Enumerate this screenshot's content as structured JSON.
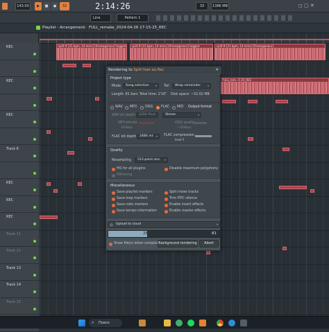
{
  "topbar": {
    "tempo": "143.00",
    "pattern_num": "32",
    "time": "2:14:26",
    "mode": "Line",
    "pattern": "Pattern 1",
    "cpu": "1386 MB",
    "poly": "33"
  },
  "playlist": {
    "title": "Playlist - Arrangement",
    "subtitle": "FULL_remake_2024-04-26 17-15-25_REC",
    "tracks": [
      {
        "name": "REC",
        "dim": false
      },
      {
        "name": "",
        "dim": false
      },
      {
        "name": "REC",
        "dim": false
      },
      {
        "name": "",
        "dim": false
      },
      {
        "name": "REC",
        "dim": false
      },
      {
        "name": "",
        "dim": false
      },
      {
        "name": "Track 6",
        "dim": false
      },
      {
        "name": "",
        "dim": false
      },
      {
        "name": "REC",
        "dim": false
      },
      {
        "name": "REC",
        "dim": false
      },
      {
        "name": "REC",
        "dim": false
      },
      {
        "name": "Track 11",
        "dim": true
      },
      {
        "name": "Track 12",
        "dim": true
      },
      {
        "name": "Track 13",
        "dim": false
      },
      {
        "name": "Track 14",
        "dim": false
      },
      {
        "name": "Track 15",
        "dim": true
      },
      {
        "name": "Track 16",
        "dim": true
      }
    ],
    "clip_labels": {
      "c1": "split ft [31 bpm, 14 mins] [thresagonour] tagged",
      "c2": "split ft [31 bpm, 14 mins] [thresagonour] tagged",
      "c3": "split ft [31 bpm, 14 mins] [thresagonour]",
      "c4": "FULL_rem...5 25_REC"
    }
  },
  "dialog": {
    "title_prefix": "Rendering to",
    "title_file": "Split feat ex.flac",
    "project_type": "Project type",
    "mode_label": "Mode",
    "mode_value": "Song selection",
    "tail_label": "Tail",
    "tail_value": "Wrap remainder",
    "length": "Length: 81 bars",
    "total_time": "Total time: 2'16\"",
    "disk_space": "Disk space: ~32.02 MB",
    "formats": [
      "WAV",
      "MP3",
      "OGG",
      "FLAC",
      "MID"
    ],
    "output_format": "Output format",
    "wav_bit_depth": "WAV bit depth",
    "wav_bit_value": "32Bit float",
    "channels_value": "Stereo",
    "mp3_bitrate": "MP3 bitrate",
    "mp3_sub": "320kbps",
    "ogg_quality": "OGG quality",
    "ogg_sub": "~320kbps",
    "flac_bit_depth": "FLAC bit depth",
    "flac_bit_value": "24Bit int",
    "flac_compression": "FLAC compression",
    "flac_comp_sub": "level 5",
    "quality": "Quality",
    "resampling_label": "Resampling",
    "resampling_value": "512-point sinc",
    "hq_plugins": "HQ for all plugins",
    "disable_max_poly": "Disable maximum polyphony",
    "dithering": "Dithering",
    "misc": "Miscellaneous",
    "save_playlist_markers": "Save playlist markers",
    "split_mixer_tracks": "Split mixer tracks",
    "save_loop_markers": "Save loop markers",
    "trim_pdc_silence": "Trim PDC silence",
    "save_note_markers": "Save note markers",
    "enable_insert_effects": "Enable insert effects",
    "save_tempo_information": "Save tempo information",
    "enable_master_effects": "Enable master effects",
    "upload_to_cloud": "Upload to cloud",
    "progress_value": "28",
    "progress_total": "81",
    "progress_fraction": 0.35,
    "show_files": "Show file(s) when complete",
    "background_rendering": "Background rendering",
    "abort": "Abort"
  },
  "taskbar": {
    "search": "Поиск"
  },
  "colors": {
    "accent": "#f0864a",
    "clip": "#b3525a"
  }
}
